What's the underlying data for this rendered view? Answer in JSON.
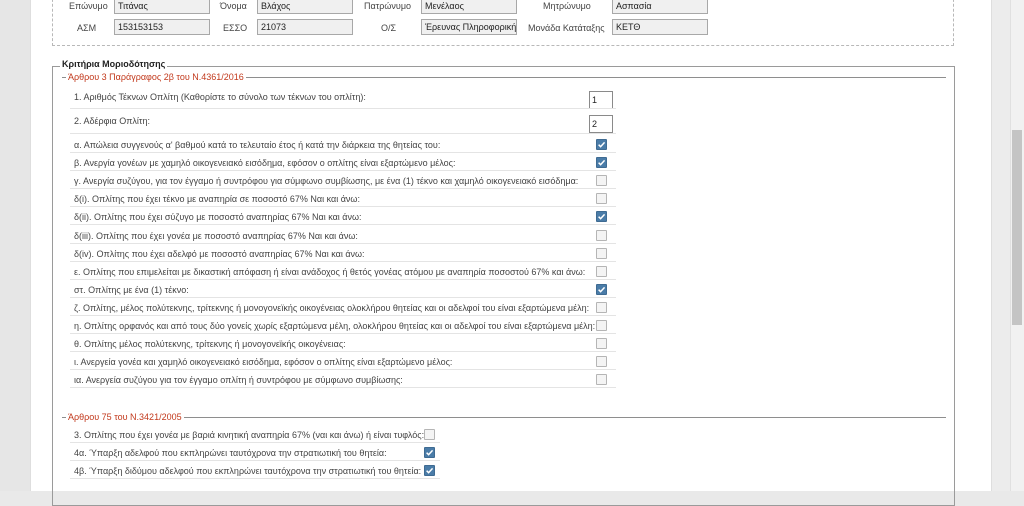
{
  "header": {
    "surname_label": "Επώνυμο",
    "surname": "Τιτάνας",
    "name_label": "Όνομα",
    "name": "Βλάχος",
    "father_label": "Πατρώνυμο",
    "father": "Μενέλαος",
    "mother_label": "Μητρώνυμο",
    "mother": "Ασπασία",
    "asm_label": "ΑΣΜ",
    "asm": "153153153",
    "esso_label": "ΕΣΣΟ",
    "esso": "21073",
    "os_label": "Ο/Σ",
    "os": "Έρευνας Πληροφορικής",
    "unit_label": "Μονάδα Κατάταξης",
    "unit": "ΚΕΤΘ"
  },
  "criteria": {
    "legend": "Κριτήρια Μοριοδότησης",
    "section1": {
      "legend": "Άρθρου 3 Παράγραφος 2β του Ν.4361/2016",
      "children_label": "1. Αριθμός Τέκνων Οπλίτη (Καθορίστε το σύνολο των τέκνων του οπλίτη):",
      "children_value": "1",
      "siblings_label": "2. Αδέρφια Οπλίτη:",
      "siblings_value": "2",
      "items": [
        {
          "label": "α. Απώλεια συγγενούς α' βαθμού κατά το τελευταίο έτος ή κατά την διάρκεια της θητείας του:",
          "checked": true
        },
        {
          "label": "β. Ανεργία γονέων με χαμηλό οικογενειακό εισόδημα, εφόσον ο οπλίτης είναι εξαρτώμενο μέλος:",
          "checked": true
        },
        {
          "label": "γ. Ανεργία συζύγου, για τον έγγαμο ή συντρόφου για σύμφωνο συμβίωσης, με ένα (1) τέκνο και χαμηλό οικογενειακό εισόδημα:",
          "checked": false
        },
        {
          "label": "δ(i). Οπλίτης που έχει τέκνο με αναπηρία σε ποσοστό 67% Ναι και άνω:",
          "checked": false
        },
        {
          "label": "δ(ii). Οπλίτης που έχει σύζυγο με ποσοστό αναπηρίας 67% Ναι και άνω:",
          "checked": true
        },
        {
          "label": "δ(iii). Οπλίτης που έχει γονέα με ποσοστό αναπηρίας 67% Ναι και άνω:",
          "checked": false
        },
        {
          "label": "δ(iv). Οπλίτης που έχει αδελφό με ποσοστό αναπηρίας 67% Ναι και άνω:",
          "checked": false
        },
        {
          "label": "ε. Οπλίτης που επιμελείται με δικαστική απόφαση ή είναι ανάδοχος ή θετός γονέας ατόμου με αναπηρία ποσοστού 67% και άνω:",
          "checked": false
        },
        {
          "label": "στ. Οπλίτης με ένα (1) τέκνο:",
          "checked": true
        },
        {
          "label": "ζ. Οπλίτης, μέλος πολύτεκνης, τρίτεκνης ή μονογονεϊκής οικογένειας ολοκλήρου θητείας και οι αδελφοί του είναι εξαρτώμενα μέλη:",
          "checked": false
        },
        {
          "label": "η. Οπλίτης ορφανός και από τους δύο γονείς χωρίς εξαρτώμενα μέλη, ολοκλήρου θητείας και οι αδελφοί του είναι εξαρτώμενα μέλη:",
          "checked": false
        },
        {
          "label": "θ. Οπλίτης μέλος πολύτεκνης, τρίτεκνης ή μονογονεϊκής οικογένειας:",
          "checked": false
        },
        {
          "label": "ι. Ανεργεία γονέα και χαμηλό οικογενειακό εισόδημα, εφόσον ο οπλίτης είναι εξαρτώμενο μέλος:",
          "checked": false
        },
        {
          "label": "ια. Ανεργεία συζύγου για τον έγγαμο οπλίτη ή συντρόφου με σύμφωνο συμβίωσης:",
          "checked": false
        }
      ]
    },
    "section2": {
      "legend": "Άρθρου 75 του Ν.3421/2005",
      "items": [
        {
          "label": "3. Οπλίτης που έχει γονέα με βαριά κινητική αναπηρία 67% (ναι και άνω) ή είναι τυφλός:",
          "checked": false
        },
        {
          "label": "4α. Ύπαρξη αδελφού που εκπληρώνει ταυτόχρονα την στρατιωτική του θητεία:",
          "checked": true
        },
        {
          "label": "4β. Ύπαρξη διδύμου αδελφού που εκπληρώνει ταυτόχρονα την στρατιωτική του θητεία:",
          "checked": true
        }
      ]
    }
  },
  "colors": {
    "checkbox_checked": "#4a7ca8",
    "legend_red": "#c2391c"
  }
}
